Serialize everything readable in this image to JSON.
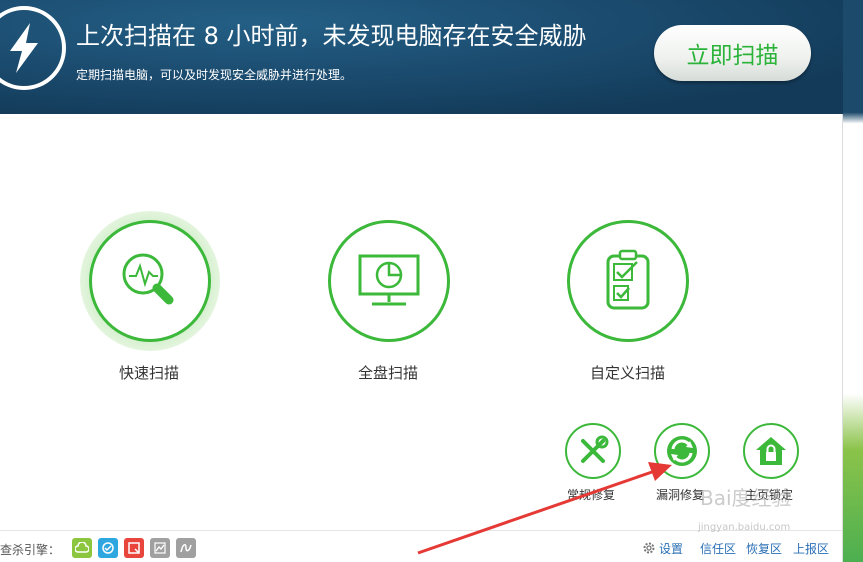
{
  "banner": {
    "title": "上次扫描在 8 小时前，未发现电脑存在安全威胁",
    "subtitle": "定期扫描电脑，可以及时发现安全威胁并进行处理。",
    "scan_button": "立即扫描"
  },
  "modes": [
    {
      "label": "快速扫描",
      "icon": "magnifier-pulse-icon"
    },
    {
      "label": "全盘扫描",
      "icon": "monitor-icon"
    },
    {
      "label": "自定义扫描",
      "icon": "clipboard-check-icon"
    }
  ],
  "tools": [
    {
      "label": "常规修复",
      "icon": "wrench-screwdriver-icon"
    },
    {
      "label": "漏洞修复",
      "icon": "shield-refresh-icon"
    },
    {
      "label": "主页锁定",
      "icon": "home-lock-icon"
    }
  ],
  "footer": {
    "engine_label": "查杀引擎：",
    "engines": [
      {
        "icon": "cloud-engine-icon",
        "color": "#8cc63f"
      },
      {
        "icon": "circle-engine-icon",
        "color": "#2ea7e0"
      },
      {
        "icon": "q-engine-icon",
        "color": "#e8463c"
      },
      {
        "icon": "chart-engine-icon",
        "color": "#a0a0a0"
      },
      {
        "icon": "wave-engine-icon",
        "color": "#a0a0a0"
      }
    ],
    "links": [
      "设置",
      "信任区",
      "恢复区",
      "上报区"
    ]
  },
  "watermark": {
    "main": "Bai度经验",
    "sub": "jingyan.baidu.com"
  },
  "colors": {
    "accent": "#3cb83a",
    "banner": "#1a4a6d",
    "link": "#2a6fb5",
    "arrow": "#e53935"
  }
}
